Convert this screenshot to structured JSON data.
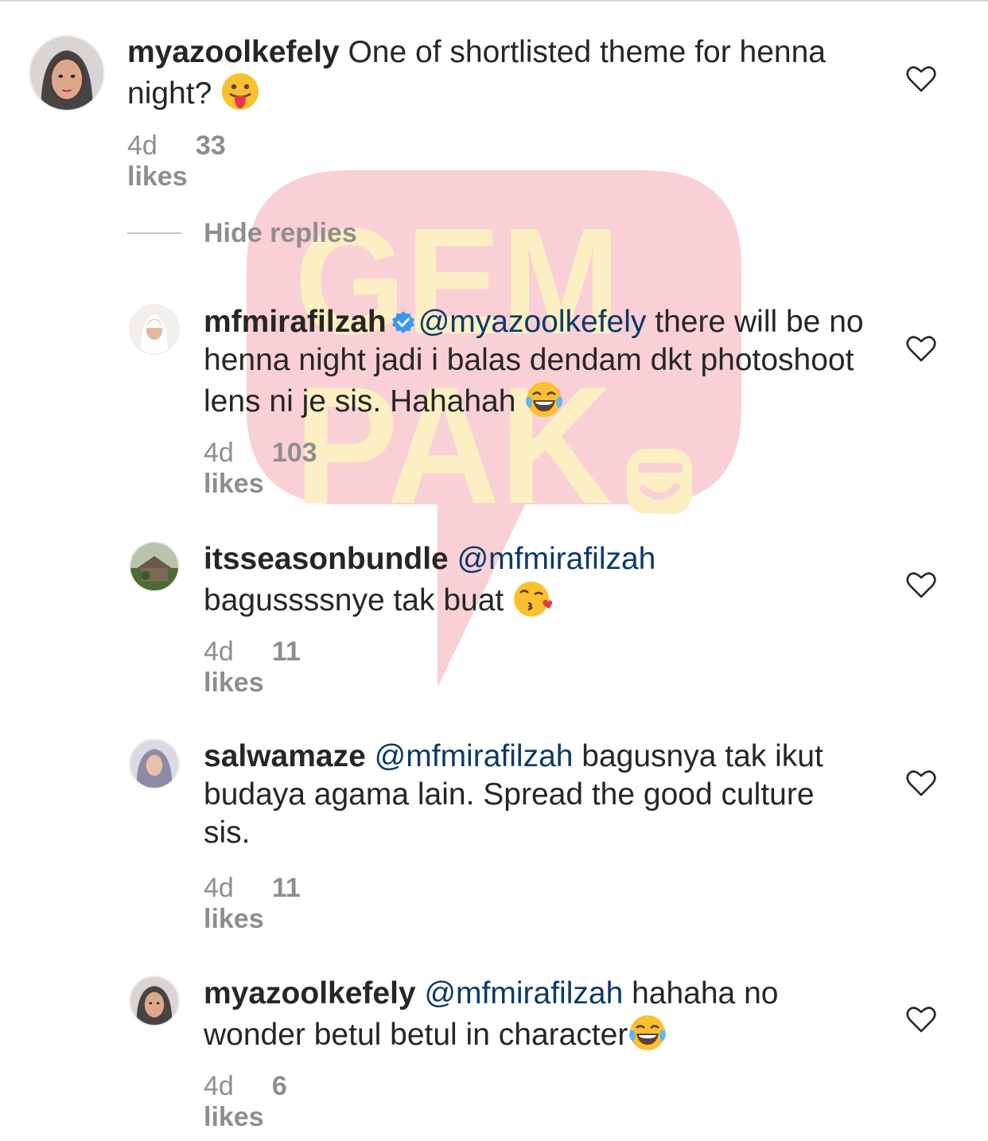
{
  "watermark": {
    "line1": "GEM",
    "line2": "PAK"
  },
  "hide_replies": "Hide replies",
  "comments": [
    {
      "username": "myazoolkefely",
      "text": "One of shortlisted theme for henna night?",
      "emoji": "tongue-emoji",
      "time": "4d",
      "likes": "33 likes"
    },
    {
      "username": "mfmirafilzah",
      "verified": true,
      "mention": "@myazoolkefely",
      "text": " there will be no henna night jadi i balas dendam dkt photoshoot lens ni je sis. Hahahah ",
      "emoji": "laughing-tears-emoji",
      "time": "4d",
      "likes": "103 likes"
    },
    {
      "username": "itsseasonbundle",
      "mention": "@mfmirafilzah",
      "text": "bagussssnye tak buat ",
      "emoji": "kiss-emoji",
      "time": "4d",
      "likes": "11 likes"
    },
    {
      "username": "salwamaze",
      "mention": "@mfmirafilzah",
      "text": " bagusnya tak ikut budaya agama lain. Spread the good culture sis.",
      "time": "4d",
      "likes": "11 likes"
    },
    {
      "username": "myazoolkefely",
      "mention": "@mfmirafilzah",
      "text": " hahaha no wonder betul betul in character",
      "emoji": "laughing-tears-emoji",
      "time": "4d",
      "likes": "6 likes"
    }
  ],
  "colors": {
    "mention": "#0b3a66",
    "meta": "#8e8e8e",
    "watermark_bubble": "#f9d0d6",
    "watermark_text": "#fcefc3"
  }
}
